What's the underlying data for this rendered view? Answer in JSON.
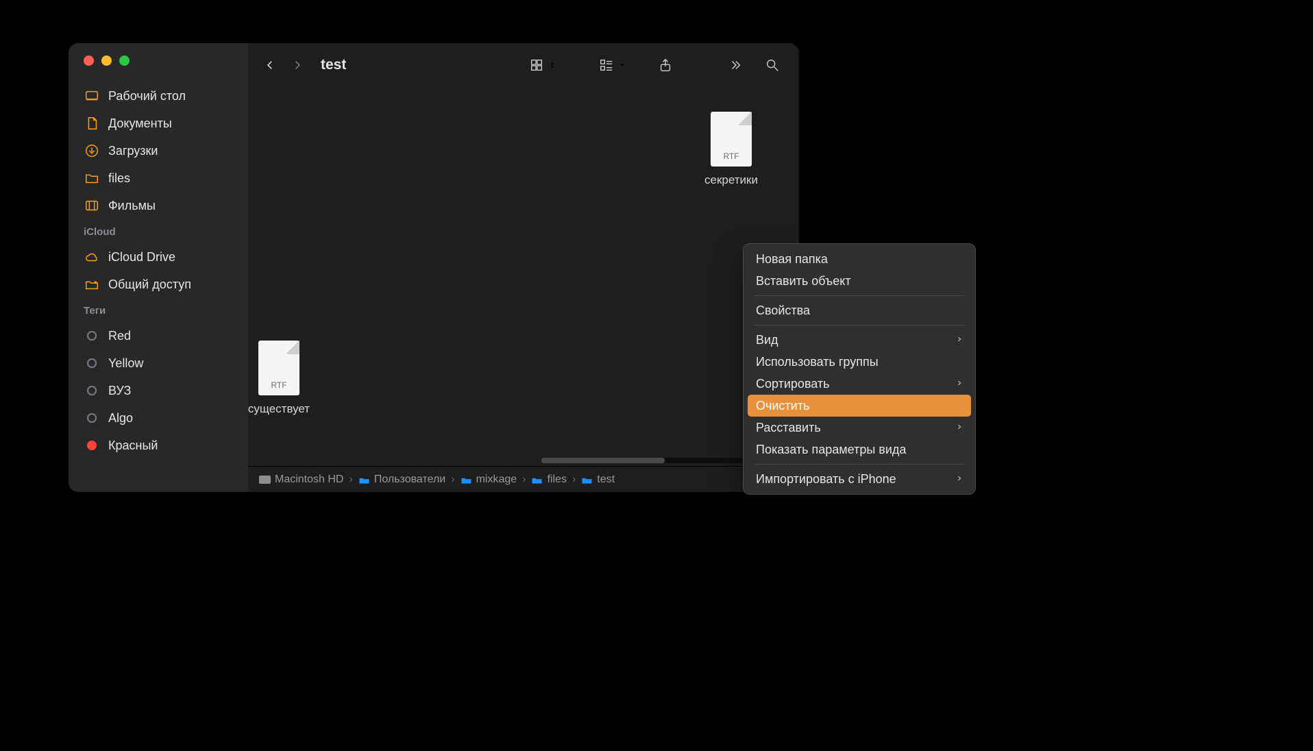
{
  "window": {
    "title": "test"
  },
  "sidebar": {
    "favorites": [
      {
        "id": "desktop",
        "label": "Рабочий стол",
        "iconKey": "desktop"
      },
      {
        "id": "documents",
        "label": "Документы",
        "iconKey": "document"
      },
      {
        "id": "downloads",
        "label": "Загрузки",
        "iconKey": "download"
      },
      {
        "id": "files",
        "label": "files",
        "iconKey": "folder"
      },
      {
        "id": "movies",
        "label": "Фильмы",
        "iconKey": "movie"
      }
    ],
    "icloud_header": "iCloud",
    "icloud": [
      {
        "id": "icloud-drive",
        "label": "iCloud Drive",
        "iconKey": "cloud"
      },
      {
        "id": "shared",
        "label": "Общий доступ",
        "iconKey": "shared-folder"
      }
    ],
    "tags_header": "Теги",
    "tags": [
      {
        "id": "tag-red",
        "label": "Red",
        "fill": false,
        "color": "#7b7b80"
      },
      {
        "id": "tag-yellow",
        "label": "Yellow",
        "fill": false,
        "color": "#7b7b80"
      },
      {
        "id": "tag-vuz",
        "label": "ВУЗ",
        "fill": false,
        "color": "#7b7b80"
      },
      {
        "id": "tag-algo",
        "label": "Algo",
        "fill": false,
        "color": "#7b7b80"
      },
      {
        "id": "tag-krasny",
        "label": "Красный",
        "fill": true,
        "color": "#ff453a"
      }
    ]
  },
  "files": [
    {
      "name": "секретики",
      "ext": "RTF"
    },
    {
      "name": "существует",
      "ext": "RTF"
    }
  ],
  "pathbar": [
    {
      "label": "Macintosh HD",
      "iconType": "disk"
    },
    {
      "label": "Пользователи",
      "iconType": "home"
    },
    {
      "label": "mixkage",
      "iconType": "home"
    },
    {
      "label": "files",
      "iconType": "folder"
    },
    {
      "label": "test",
      "iconType": "folder"
    }
  ],
  "context_menu": [
    {
      "label": "Новая папка",
      "sub": false,
      "sep": false
    },
    {
      "label": "Вставить объект",
      "sub": false,
      "sep": false
    },
    {
      "sep": true
    },
    {
      "label": "Свойства",
      "sub": false,
      "sep": false
    },
    {
      "sep": true
    },
    {
      "label": "Вид",
      "sub": true,
      "sep": false
    },
    {
      "label": "Использовать группы",
      "sub": false,
      "sep": false
    },
    {
      "label": "Сортировать",
      "sub": true,
      "sep": false
    },
    {
      "label": "Очистить",
      "sub": false,
      "sep": false,
      "highlight": true
    },
    {
      "label": "Расставить",
      "sub": true,
      "sep": false
    },
    {
      "label": "Показать параметры вида",
      "sub": false,
      "sep": false
    },
    {
      "sep": true
    },
    {
      "label": "Импортировать с iPhone",
      "sub": true,
      "sep": false
    }
  ]
}
